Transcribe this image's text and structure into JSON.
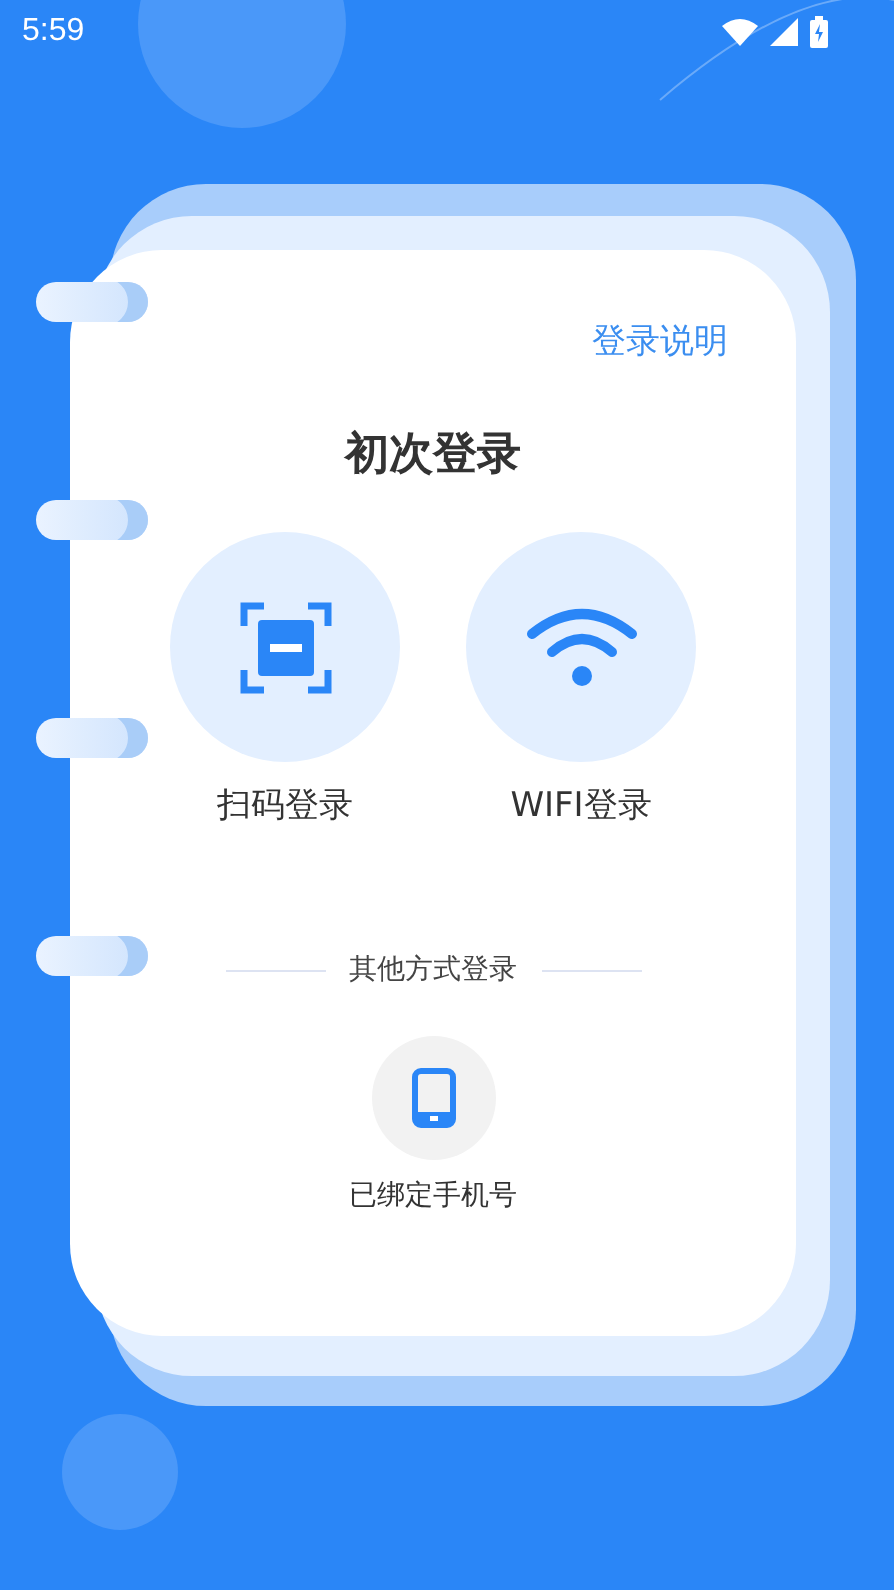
{
  "status_bar": {
    "time": "5:59"
  },
  "help_link": "登录说明",
  "title": "初次登录",
  "login_options": [
    {
      "kind": "scan",
      "label": "扫码登录"
    },
    {
      "kind": "wifi",
      "label": "WIFI登录"
    }
  ],
  "divider_text": "其他方式登录",
  "other_options": [
    {
      "kind": "phone",
      "label": "已绑定手机号"
    }
  ]
}
